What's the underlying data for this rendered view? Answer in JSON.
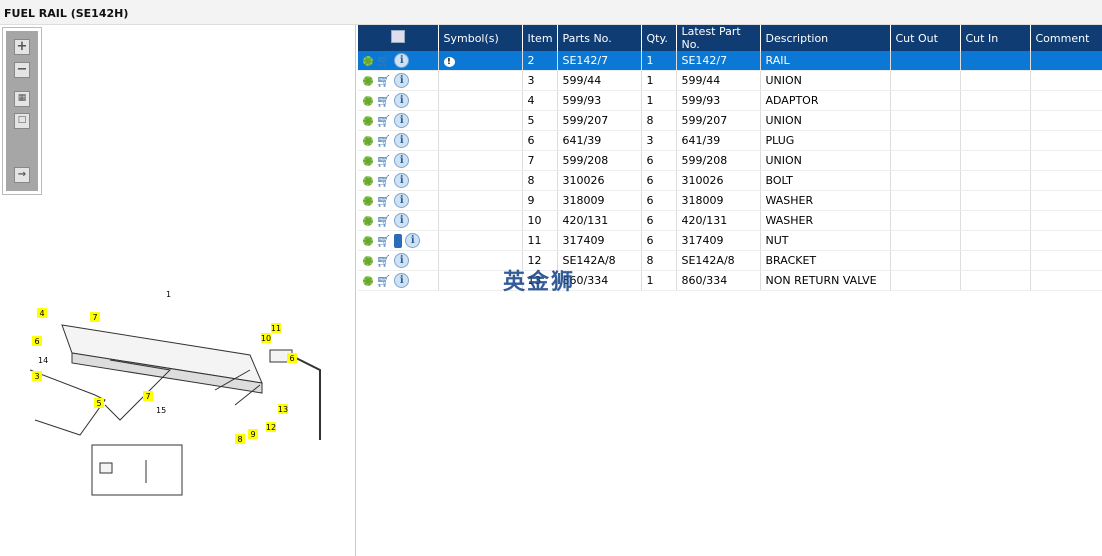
{
  "window": {
    "title": "FUEL RAIL (SE142H)"
  },
  "toolbar": {
    "icons": [
      "zoom-in-icon",
      "zoom-out-icon",
      "fit-all-icon",
      "fit-page-icon",
      "export-icon"
    ]
  },
  "diagram": {
    "callouts": [
      "1",
      "3",
      "4",
      "5",
      "6",
      "6",
      "7",
      "7",
      "8",
      "9",
      "10",
      "11",
      "12",
      "13",
      "14",
      "15"
    ]
  },
  "table": {
    "headers": [
      "",
      "Symbol(s)",
      "Item",
      "Parts No.",
      "Qty.",
      "Latest Part No.",
      "Description",
      "Cut Out",
      "Cut In",
      "Comment"
    ],
    "rows": [
      {
        "item": "2",
        "part": "SE142/7",
        "qty": "1",
        "latest": "SE142/7",
        "desc": "RAIL",
        "selected": true,
        "symbol": "warning-bubble-icon"
      },
      {
        "item": "3",
        "part": "599/44",
        "qty": "1",
        "latest": "599/44",
        "desc": "UNION"
      },
      {
        "item": "4",
        "part": "599/93",
        "qty": "1",
        "latest": "599/93",
        "desc": "ADAPTOR"
      },
      {
        "item": "5",
        "part": "599/207",
        "qty": "8",
        "latest": "599/207",
        "desc": "UNION"
      },
      {
        "item": "6",
        "part": "641/39",
        "qty": "3",
        "latest": "641/39",
        "desc": "PLUG"
      },
      {
        "item": "7",
        "part": "599/208",
        "qty": "6",
        "latest": "599/208",
        "desc": "UNION"
      },
      {
        "item": "8",
        "part": "310026",
        "qty": "6",
        "latest": "310026",
        "desc": "BOLT"
      },
      {
        "item": "9",
        "part": "318009",
        "qty": "6",
        "latest": "318009",
        "desc": "WASHER"
      },
      {
        "item": "10",
        "part": "420/131",
        "qty": "6",
        "latest": "420/131",
        "desc": "WASHER"
      },
      {
        "item": "11",
        "part": "317409",
        "qty": "6",
        "latest": "317409",
        "desc": "NUT",
        "book": true
      },
      {
        "item": "12",
        "part": "SE142A/8",
        "qty": "8",
        "latest": "SE142A/8",
        "desc": "BRACKET"
      },
      {
        "item": "13",
        "part": "860/334",
        "qty": "1",
        "latest": "860/334",
        "desc": "NON RETURN VALVE"
      }
    ]
  },
  "watermark": "英金狮"
}
